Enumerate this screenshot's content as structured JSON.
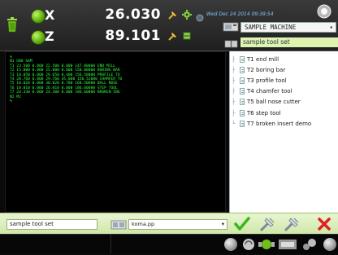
{
  "header": {
    "x_axis": {
      "letter": "X",
      "value": "26.030"
    },
    "z_axis": {
      "letter": "Z",
      "value": "89.101"
    },
    "datetime": "Wed Dec 24 2014 09:39:54",
    "machine": {
      "selected": "SAMPLE MACHINE",
      "arrow": "▾"
    },
    "tool_set_label": "sample tool set"
  },
  "console": {
    "lines": [
      "%",
      "N1 O88 SAM",
      "T1 23.500 0.000 22.500 0.000 147.00000 END MILL",
      "T2 15.000 0.000 25.000 0.000 150.00000 BORING BAR",
      "T3 10.050 0.000 29.650 0.400 156.50000 PROFILE TO",
      "T4 28.760 0.000 29.760 45.000 150.52000 CHAMFER TO",
      "T5 10.020 0.000 30.020 0.780 168.50000 BALL NOSE",
      "T6 18.010 0.000 26.010 0.000 186.60000 STEP TOOL",
      "T7 24.330 0.000 24.300 0.000 186.60000 BROKEN INS",
      "N2 M2",
      "%"
    ]
  },
  "tools": [
    {
      "label": "T1 end mill"
    },
    {
      "label": "T2 boring bar"
    },
    {
      "label": "T3 profile tool"
    },
    {
      "label": "T4 chamfer tool"
    },
    {
      "label": "T5 ball nose cutter"
    },
    {
      "label": "T6 step tool"
    },
    {
      "label": "T7 broken insert demo"
    }
  ],
  "bottom": {
    "tool_set_name": "sample tool set",
    "postprocessor": {
      "selected": "koma.pp",
      "arrow": "▾"
    }
  },
  "colors": {
    "console_text": "#30ff40",
    "accent_green": "#39b81a",
    "danger_red": "#e02020",
    "date_blue": "#7ec4ff"
  },
  "icons": {
    "trash": "trash-icon",
    "pin": "pin-icon",
    "gear": "gear-icon",
    "ok": "checkmark-icon",
    "cancel": "close-icon"
  }
}
